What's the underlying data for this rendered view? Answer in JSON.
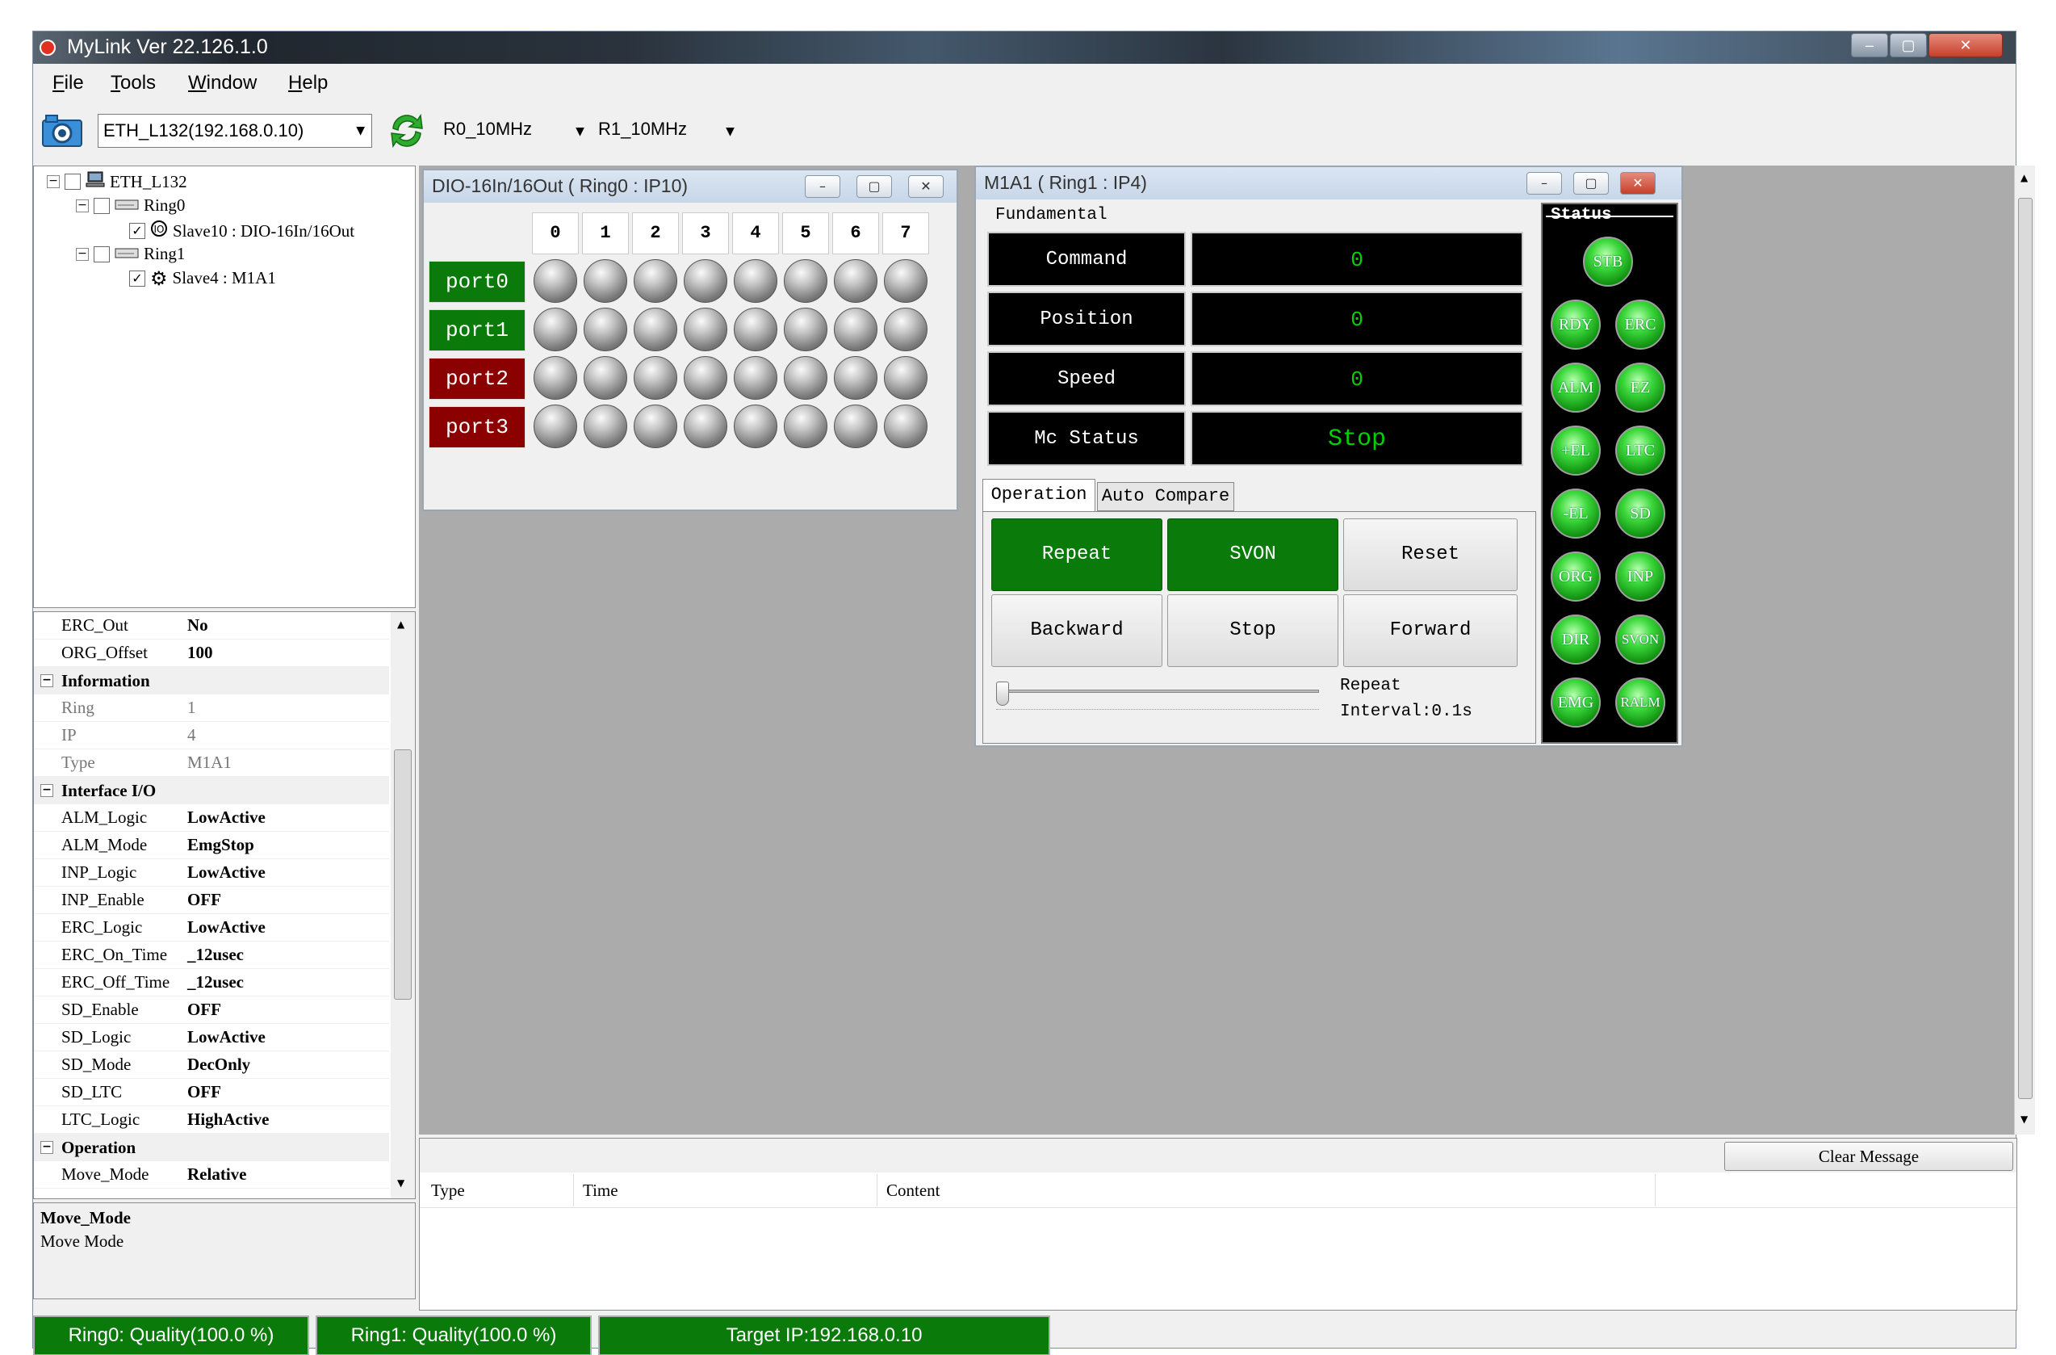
{
  "window": {
    "title": "MyLink  Ver 22.126.1.0",
    "controls": [
      "–",
      "▢",
      "✕"
    ]
  },
  "menu": [
    {
      "label": "File",
      "key": "F",
      "rest": "ile"
    },
    {
      "label": "Tools",
      "key": "T",
      "rest": "ools"
    },
    {
      "label": "Window",
      "key": "W",
      "rest": "indow"
    },
    {
      "label": "Help",
      "key": "H",
      "rest": "elp"
    }
  ],
  "toolbar": {
    "device": "ETH_L132(192.168.0.10)",
    "ring0_speed": "R0_10MHz",
    "ring1_speed": "R1_10MHz"
  },
  "tree": {
    "root": "ETH_L132",
    "ring0": "Ring0",
    "slave10": "Slave10 : DIO-16In/16Out",
    "ring1": "Ring1",
    "slave4": "Slave4 : M1A1"
  },
  "properties": {
    "erc_out": {
      "k": "ERC_Out",
      "v": "No"
    },
    "org_offset": {
      "k": "ORG_Offset",
      "v": "100"
    },
    "cat_information": "Information",
    "ring": {
      "k": "Ring",
      "v": "1"
    },
    "ip": {
      "k": "IP",
      "v": "4"
    },
    "type": {
      "k": "Type",
      "v": "M1A1"
    },
    "cat_interface": "Interface I/O",
    "alm_logic": {
      "k": "ALM_Logic",
      "v": "LowActive"
    },
    "alm_mode": {
      "k": "ALM_Mode",
      "v": "EmgStop"
    },
    "inp_logic": {
      "k": "INP_Logic",
      "v": "LowActive"
    },
    "inp_enable": {
      "k": "INP_Enable",
      "v": "OFF"
    },
    "erc_logic": {
      "k": "ERC_Logic",
      "v": "LowActive"
    },
    "erc_on_time": {
      "k": "ERC_On_Time",
      "v": "_12usec"
    },
    "erc_off_time": {
      "k": "ERC_Off_Time",
      "v": "_12usec"
    },
    "sd_enable": {
      "k": "SD_Enable",
      "v": "OFF"
    },
    "sd_logic": {
      "k": "SD_Logic",
      "v": "LowActive"
    },
    "sd_mode": {
      "k": "SD_Mode",
      "v": "DecOnly"
    },
    "sd_ltc": {
      "k": "SD_LTC",
      "v": "OFF"
    },
    "ltc_logic": {
      "k": "LTC_Logic",
      "v": "HighActive"
    },
    "cat_operation": "Operation",
    "move_mode": {
      "k": "Move_Mode",
      "v": "Relative"
    }
  },
  "description": {
    "title": "Move_Mode",
    "text": "Move Mode"
  },
  "dio_window": {
    "title": "DIO-16In/16Out ( Ring0 : IP10)",
    "bits": [
      "0",
      "1",
      "2",
      "3",
      "4",
      "5",
      "6",
      "7"
    ],
    "ports": [
      "port0",
      "port1",
      "port2",
      "port3"
    ],
    "port_colors": [
      "#0a7a0a",
      "#0a7a0a",
      "#8b0000",
      "#8b0000"
    ]
  },
  "motion_window": {
    "title": "M1A1 ( Ring1 : IP4)",
    "fundamental_label": "Fundamental",
    "command": {
      "label": "Command",
      "value": "0"
    },
    "position": {
      "label": "Position",
      "value": "0"
    },
    "speed": {
      "label": "Speed",
      "value": "0"
    },
    "mc_status": {
      "label": "Mc Status",
      "value": "Stop"
    },
    "tabs": [
      "Operation",
      "Auto Compare"
    ],
    "buttons": {
      "repeat": "Repeat",
      "svon": "SVON",
      "reset": "Reset",
      "backward": "Backward",
      "stop": "Stop",
      "forward": "Forward"
    },
    "repeat_interval": {
      "line1": "Repeat",
      "line2": "Interval:0.1s"
    },
    "status_label": "Status",
    "status_leds": [
      "STB",
      "RDY",
      "ERC",
      "ALM",
      "EZ",
      "+EL",
      "LTC",
      "-EL",
      "SD",
      "ORG",
      "INP",
      "DIR",
      "SVON",
      "EMG",
      "RALM"
    ]
  },
  "messages": {
    "clear_button": "Clear Message",
    "columns": [
      "Type",
      "Time",
      "Content"
    ]
  },
  "statusbar": {
    "ring0": "Ring0: Quality(100.0 %)",
    "ring1": "Ring1: Quality(100.0 %)",
    "target": "Target IP:192.168.0.10"
  },
  "colors": {
    "status_green": "#0a7a0a",
    "port_red": "#8b0000",
    "value_green": "#00d000"
  }
}
